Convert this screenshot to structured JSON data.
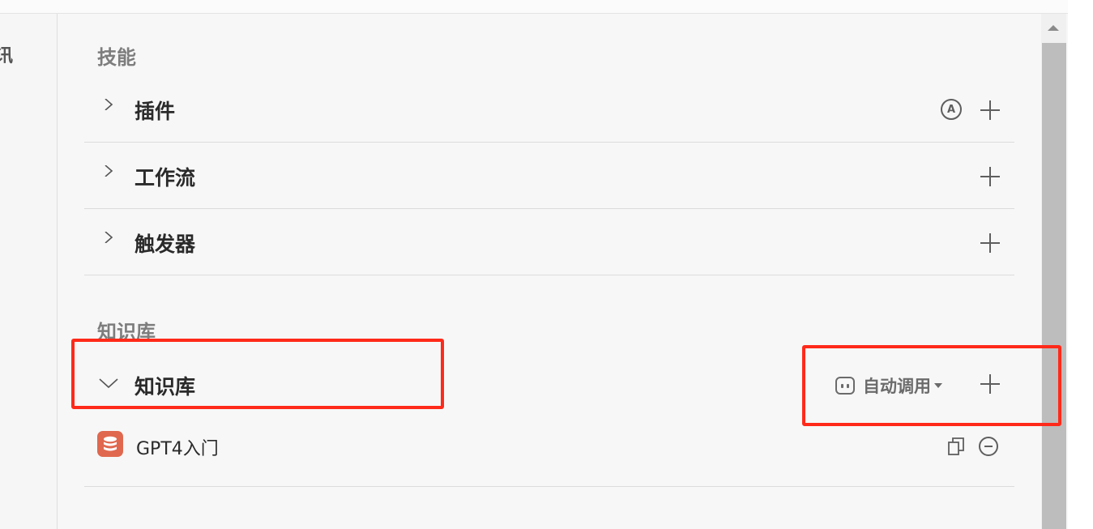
{
  "left_fragment": "讯",
  "skills": {
    "title": "技能",
    "items": [
      {
        "label": "插件",
        "auto_badge": "A"
      },
      {
        "label": "工作流"
      },
      {
        "label": "触发器"
      }
    ]
  },
  "knowledge": {
    "title": "知识库",
    "group_label": "知识库",
    "auto_call_label": "自动调用",
    "items": [
      {
        "name": "GPT4入门"
      }
    ]
  },
  "colors": {
    "highlight": "#ff2a1a",
    "db_icon": "#e0684e"
  },
  "icons": [
    "chevron-right-icon",
    "chevron-down-icon",
    "plus-icon",
    "auto-a-icon",
    "bot-icon",
    "database-icon",
    "copy-icon",
    "minus-circle-icon"
  ]
}
